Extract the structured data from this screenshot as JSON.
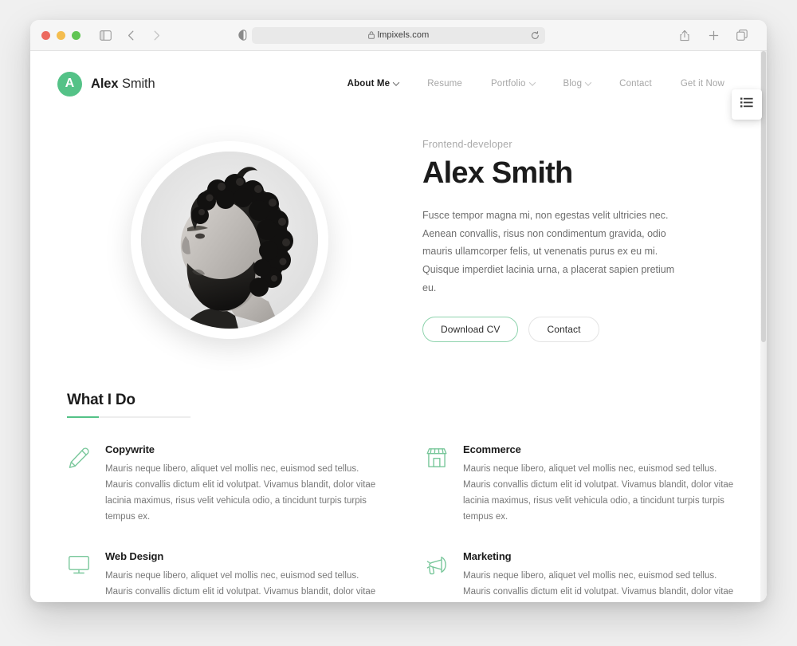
{
  "browser": {
    "url": "lmpixels.com",
    "lock_icon": "lock-icon",
    "reader_icon": "reader-view-icon",
    "reload_icon": "reload-icon",
    "sidebar_icon": "sidebar-toggle-icon",
    "back_icon": "back-chevron-icon",
    "forward_icon": "forward-chevron-icon",
    "share_icon": "share-icon",
    "new_tab_icon": "plus-icon",
    "tabs_icon": "tab-overview-icon"
  },
  "site": {
    "logo": {
      "badge_letter": "A",
      "first_name": "Alex",
      "last_name": "Smith",
      "accent_color": "#54c287"
    },
    "nav": [
      {
        "label": "About Me",
        "has_dropdown": true,
        "active": true
      },
      {
        "label": "Resume",
        "has_dropdown": false,
        "active": false
      },
      {
        "label": "Portfolio",
        "has_dropdown": true,
        "active": false
      },
      {
        "label": "Blog",
        "has_dropdown": true,
        "active": false
      },
      {
        "label": "Contact",
        "has_dropdown": false,
        "active": false
      },
      {
        "label": "Get it Now",
        "has_dropdown": false,
        "active": false
      }
    ],
    "side_button_icon": "list-menu-icon"
  },
  "hero": {
    "subtitle": "Frontend-developer",
    "title": "Alex Smith",
    "paragraph": "Fusce tempor magna mi, non egestas velit ultricies nec. Aenean convallis, risus non condimentum gravida, odio mauris ullamcorper felis, ut venenatis purus ex eu mi. Quisque imperdiet lacinia urna, a placerat sapien pretium eu.",
    "primary_button": "Download CV",
    "secondary_button": "Contact",
    "photo_alt": "portrait-photo"
  },
  "what_i_do": {
    "title": "What I Do",
    "accent_color": "#54c287",
    "services": [
      {
        "icon": "pencil-icon",
        "name": "Copywrite",
        "description": "Mauris neque libero, aliquet vel mollis nec, euismod sed tellus. Mauris convallis dictum elit id volutpat. Vivamus blandit, dolor vitae lacinia maximus, risus velit vehicula odio, a tincidunt turpis turpis tempus ex."
      },
      {
        "icon": "store-icon",
        "name": "Ecommerce",
        "description": "Mauris neque libero, aliquet vel mollis nec, euismod sed tellus. Mauris convallis dictum elit id volutpat. Vivamus blandit, dolor vitae lacinia maximus, risus velit vehicula odio, a tincidunt turpis turpis tempus ex."
      },
      {
        "icon": "monitor-icon",
        "name": "Web Design",
        "description": "Mauris neque libero, aliquet vel mollis nec, euismod sed tellus. Mauris convallis dictum elit id volutpat. Vivamus blandit, dolor vitae lacinia maximus, risus velit vehicula odio, a tincidunt turpis turpis tempus ex."
      },
      {
        "icon": "megaphone-icon",
        "name": "Marketing",
        "description": "Mauris neque libero, aliquet vel mollis nec, euismod sed tellus. Mauris convallis dictum elit id volutpat. Vivamus blandit, dolor vitae lacinia maximus, risus velit vehicula odio, a tincidunt turpis turpis tempus ex."
      }
    ]
  }
}
